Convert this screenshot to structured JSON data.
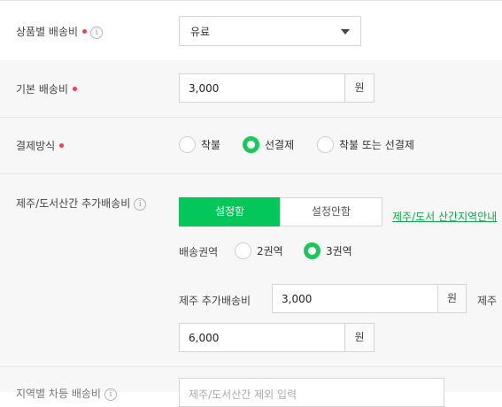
{
  "product_shipping": {
    "label": "상품별 배송비",
    "select_value": "유료"
  },
  "base_shipping": {
    "label": "기본 배송비",
    "value": "3,000",
    "unit": "원"
  },
  "payment": {
    "label": "결제방식",
    "options": [
      "착불",
      "선결제",
      "착불 또는 선결제"
    ],
    "selected": "선결제"
  },
  "jeju": {
    "label": "제주/도서산간 추가배송비",
    "toggle": {
      "on_label": "설정함",
      "off_label": "설정안함",
      "selected": "설정함"
    },
    "guide_link": "제주/도서 산간지역안내",
    "region_label": "배송권역",
    "region_options": [
      "2권역",
      "3권역"
    ],
    "region_selected": "3권역",
    "jeju_fee_label": "제주 추가배송비",
    "jeju_fee_value": "3,000",
    "unit": "원",
    "next_label": "제주",
    "second_fee_value": "6,000"
  },
  "partial": {
    "label": "지역별 차등 배송비",
    "placeholder": "제주/도서산간 제외 입력"
  },
  "colors": {
    "accent": "#03c75a",
    "required_dot": "#f23f4e",
    "link": "#11a84d"
  }
}
